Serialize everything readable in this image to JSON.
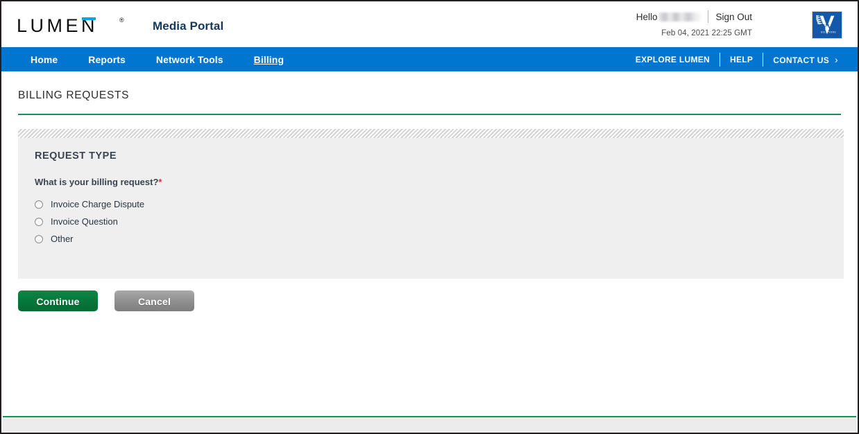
{
  "header": {
    "logo_text": "LUMΞN",
    "logo_letters": "LUMEN",
    "logo_registered": "®",
    "portal_title": "Media Portal",
    "hello_label": "Hello",
    "hello_name": "",
    "sign_out": "Sign Out",
    "datetime": "Feb 04, 2021 22:25 GMT",
    "brand_logo_alt": "Vyvx",
    "brand_logo_word": "VYVX",
    "brand_logo_sub": "SOLUTIONS",
    "accent_blue": "#00a9e0",
    "title_color": "#14375a"
  },
  "nav": {
    "primary": [
      {
        "label": "Home",
        "active": false
      },
      {
        "label": "Reports",
        "active": false
      },
      {
        "label": "Network Tools",
        "active": false
      },
      {
        "label": "Billing",
        "active": true
      }
    ],
    "secondary": [
      {
        "label": "EXPLORE LUMEN"
      },
      {
        "label": "HELP"
      },
      {
        "label": "CONTACT US"
      }
    ],
    "chevron": "›",
    "bar_color": "#0076d0"
  },
  "page": {
    "title": "BILLING REQUESTS",
    "rule_color": "#13935b"
  },
  "panel": {
    "heading": "REQUEST TYPE",
    "question": "What is your billing request?",
    "required_marker": "*",
    "options": [
      {
        "label": "Invoice Charge Dispute",
        "selected": false
      },
      {
        "label": "Invoice Question",
        "selected": false
      },
      {
        "label": "Other",
        "selected": false
      }
    ],
    "background": "#efefef"
  },
  "buttons": {
    "continue": "Continue",
    "cancel": "Cancel",
    "continue_color": "#07753a",
    "cancel_color": "#8e8e8e"
  },
  "footer": {
    "rule_color": "#13935b",
    "band_color": "#ececec"
  }
}
